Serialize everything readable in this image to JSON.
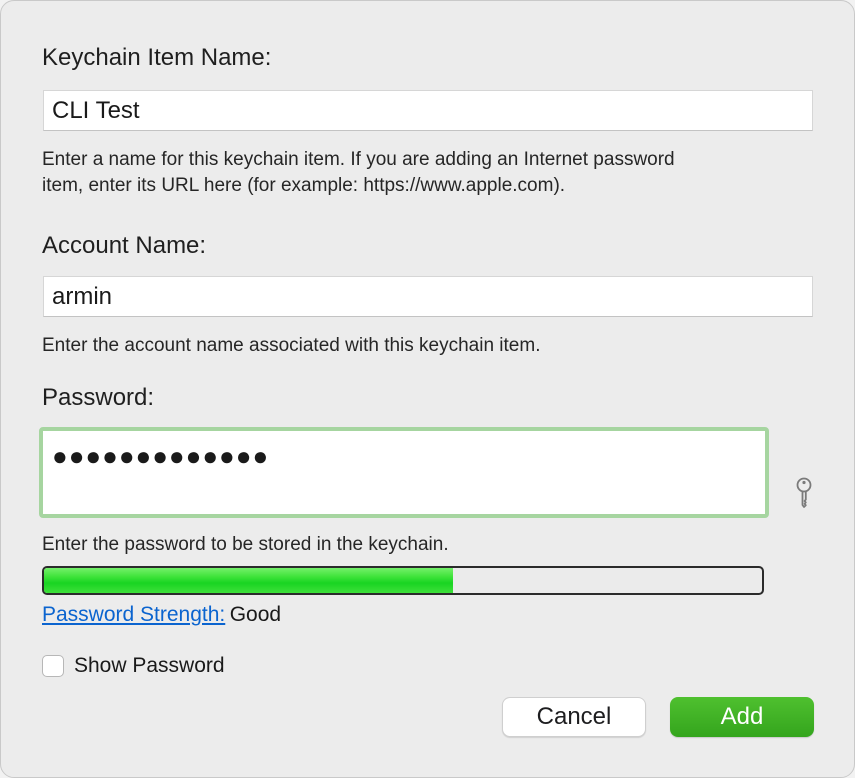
{
  "item_name": {
    "label": "Keychain Item Name:",
    "value": "CLI Test",
    "hint_line1": "Enter a name for this keychain item. If you are adding an Internet password",
    "hint_line2": "item, enter its URL here (for example: https://www.apple.com)."
  },
  "account": {
    "label": "Account Name:",
    "value": "armin",
    "hint": "Enter the account name associated with this keychain item."
  },
  "password": {
    "label": "Password:",
    "masked_value": "●●●●●●●●●●●●●",
    "hint": "Enter the password to be stored in the keychain.",
    "strength_label": "Password Strength:",
    "strength_value": "Good",
    "strength_fraction": 0.57,
    "show_password_label": "Show Password",
    "show_password_checked": false,
    "assistant_icon": "key-icon"
  },
  "buttons": {
    "cancel": "Cancel",
    "add": "Add"
  },
  "colors": {
    "focus_ring": "#a6d5a0",
    "meter_fill": "#19d422",
    "link": "#0b64cf",
    "add_button": "#34a51d"
  }
}
